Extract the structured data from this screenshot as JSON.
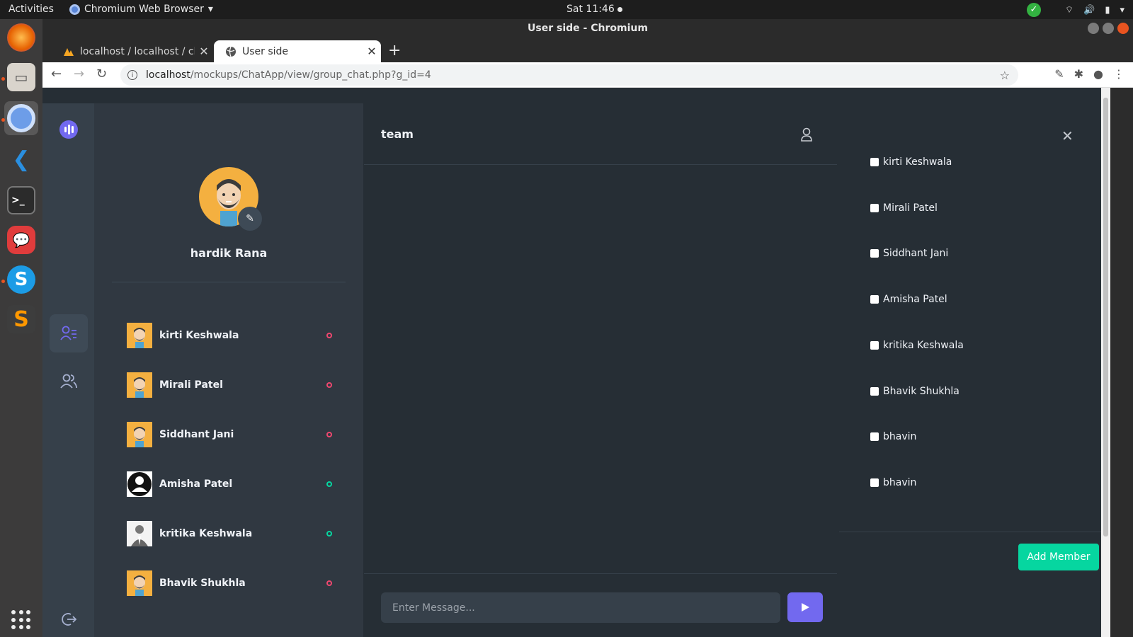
{
  "system": {
    "activities": "Activities",
    "app_menu": "Chromium Web Browser",
    "clock": "Sat 11:46"
  },
  "dock": {
    "apps": [
      "firefox-icon",
      "files-icon",
      "chromium-icon",
      "vscode-icon",
      "terminal-icon",
      "chat-app-icon",
      "skype-icon",
      "sublime-icon"
    ]
  },
  "browser": {
    "window_title": "User side - Chromium",
    "tabs": [
      {
        "label": "localhost / localhost / cha"
      },
      {
        "label": "User side"
      }
    ],
    "url_host": "localhost",
    "url_path": "/mockups/ChatApp/view/group_chat.php?g_id=4"
  },
  "profile": {
    "name": "hardik Rana",
    "users": [
      {
        "name": "kirti Keshwala",
        "status": "offline"
      },
      {
        "name": "Mirali Patel",
        "status": "offline"
      },
      {
        "name": "Siddhant Jani",
        "status": "offline"
      },
      {
        "name": "Amisha Patel",
        "status": "online"
      },
      {
        "name": "kritika Keshwala",
        "status": "online"
      },
      {
        "name": "Bhavik Shukhla",
        "status": "offline"
      }
    ]
  },
  "chat": {
    "title": "team",
    "input_placeholder": "Enter Message..."
  },
  "members": {
    "items": [
      "kirti Keshwala",
      "Mirali Patel",
      "Siddhant Jani",
      "Amisha Patel",
      "kritika Keshwala",
      "Bhavik Shukhla",
      "bhavin",
      "bhavin"
    ],
    "add_button": "Add Member"
  },
  "colors": {
    "online": "#06d6a0",
    "offline": "#ef476f",
    "accent": "#7269ef",
    "add_button": "#06d6a0"
  }
}
